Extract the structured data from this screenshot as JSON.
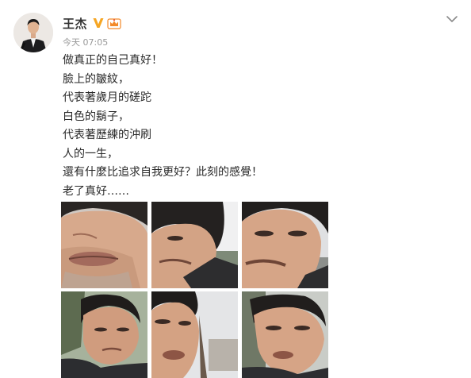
{
  "post": {
    "author": {
      "name": "王杰",
      "avatar_icon": "avatar-icon",
      "verified_icon": "verified-v-icon",
      "member_icon": "member-crown-icon",
      "verified_color": "#f6a623"
    },
    "timestamp": "今天 07:05",
    "more_icon": "chevron-down-icon",
    "lines": [
      "做真正的自己真好！",
      "臉上的皺紋，",
      "代表著歲月的磋跎",
      "白色的鬍子，",
      "代表著歷練的沖刷",
      "人的一生，",
      "還有什麼比追求自我更好？此刻的感覺！",
      "老了真好……"
    ],
    "photos": [
      {
        "icon": "selfie-photo-1"
      },
      {
        "icon": "selfie-photo-2"
      },
      {
        "icon": "selfie-photo-3"
      },
      {
        "icon": "selfie-photo-4"
      },
      {
        "icon": "selfie-photo-5"
      },
      {
        "icon": "selfie-photo-6"
      }
    ]
  }
}
